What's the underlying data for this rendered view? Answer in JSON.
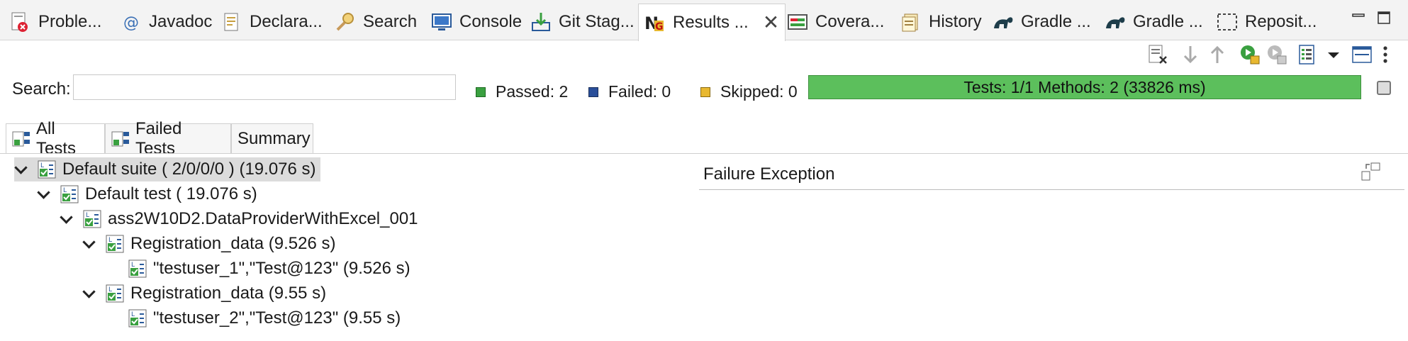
{
  "tabs": [
    {
      "label": "Proble...",
      "icon": "problems-icon"
    },
    {
      "label": "Javadoc",
      "icon": "javadoc-icon"
    },
    {
      "label": "Declara...",
      "icon": "declaration-icon"
    },
    {
      "label": "Search",
      "icon": "search-icon"
    },
    {
      "label": "Console",
      "icon": "console-icon"
    },
    {
      "label": "Git Stag...",
      "icon": "git-staging-icon"
    },
    {
      "label": "Results ...",
      "icon": "testng-icon"
    },
    {
      "label": "Covera...",
      "icon": "coverage-icon"
    },
    {
      "label": "History",
      "icon": "history-icon"
    },
    {
      "label": "Gradle ...",
      "icon": "gradle-icon"
    },
    {
      "label": "Gradle ...",
      "icon": "gradle-icon"
    },
    {
      "label": "Reposit...",
      "icon": "repository-icon"
    }
  ],
  "search": {
    "label": "Search:",
    "value": "",
    "placeholder": ""
  },
  "stats": {
    "passed": "Passed: 2",
    "failed": "Failed: 0",
    "skipped": "Skipped: 0"
  },
  "progress": {
    "text": "Tests: 1/1  Methods: 2 (33826 ms)",
    "fraction": 1.0,
    "color": "#5cbf5c"
  },
  "lower_tabs": [
    {
      "label": "All Tests"
    },
    {
      "label": "Failed Tests"
    },
    {
      "label": "Summary"
    }
  ],
  "tree": [
    {
      "label": "Default suite ( 2/0/0/0 ) (19.076 s)",
      "level": 0,
      "expanded": true,
      "selected": true
    },
    {
      "label": "Default test ( 19.076 s)",
      "level": 1,
      "expanded": true
    },
    {
      "label": "ass2W10D2.DataProviderWithExcel_001",
      "level": 2,
      "expanded": true
    },
    {
      "label": "Registration_data  (9.526 s)",
      "level": 3,
      "expanded": true
    },
    {
      "label": "\"testuser_1\",\"Test@123\"  (9.526 s)",
      "level": 4,
      "expanded": false
    },
    {
      "label": "Registration_data  (9.55 s)",
      "level": 3,
      "expanded": true
    },
    {
      "label": "\"testuser_2\",\"Test@123\"  (9.55 s)",
      "level": 4,
      "expanded": false
    }
  ],
  "failure": {
    "title": "Failure Exception"
  }
}
